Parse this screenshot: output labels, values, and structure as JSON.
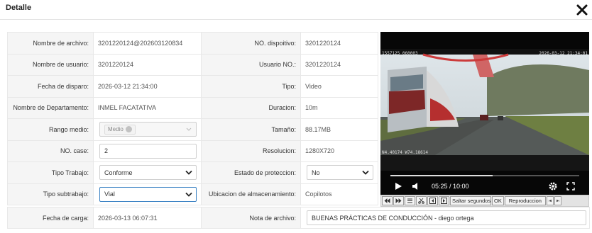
{
  "dialog": {
    "title": "Detalle",
    "close_icon": "close-icon"
  },
  "fields": {
    "nombre_archivo": {
      "label": "Nombre de archivo:",
      "value": "3201220124@202603120834"
    },
    "nombre_usuario": {
      "label": "Nombre de usuario:",
      "value": "3201220124"
    },
    "fecha_disparo": {
      "label": "Fecha de disparo:",
      "value": "2026-03-12 21:34:00"
    },
    "departamento": {
      "label": "Nombre de Departamento:",
      "value": "INMEL FACATATIVA"
    },
    "rango_medio": {
      "label": "Rango medio:",
      "tag": "Medio"
    },
    "no_case": {
      "label": "NO. case:",
      "value": "2"
    },
    "tipo_trabajo": {
      "label": "Tipo Trabajo:",
      "value": "Conforme"
    },
    "tipo_subtrabajo": {
      "label": "Tipo subtrabajo:",
      "value": "Vial"
    },
    "fecha_carga": {
      "label": "Fecha de carga:",
      "value": "2026-03-13 06:07:31"
    },
    "no_dispositivo": {
      "label": "NO. dispoitivo:",
      "value": "3201220124"
    },
    "usuario_no": {
      "label": "Usuario NO.:",
      "value": "3201220124"
    },
    "tipo": {
      "label": "Tipo:",
      "value": "Video"
    },
    "duracion": {
      "label": "Duracion:",
      "value": "10m"
    },
    "tamano": {
      "label": "Tamaño:",
      "value": "88.17MB"
    },
    "resolucion": {
      "label": "Resolucion:",
      "value": "1280X720"
    },
    "estado_proteccion": {
      "label": "Estado de proteccion:",
      "value": "No"
    },
    "ubicacion": {
      "label": "Ubicacion de almacenamiento:",
      "value": "Copilotos"
    },
    "nota": {
      "label": "Nota de archivo:",
      "value": "BUENAS PRÁCTICAS DE CONDUCCIÓN - diego ortega"
    }
  },
  "video": {
    "overlay_left": "1557125 060003",
    "overlay_right": "2026-03-12 21:34:01",
    "overlay_bottom": "N4.40174 W74.18614",
    "time": "05:25 / 10:00",
    "progress": 0.54,
    "icons": [
      "play-icon",
      "volume-icon",
      "gear-icon",
      "fullscreen-icon"
    ]
  },
  "controls": {
    "buttons": [
      {
        "name": "rewind-button",
        "icon": "rewind-icon"
      },
      {
        "name": "fast-forward-button",
        "icon": "fast-forward-icon"
      },
      {
        "name": "list-button",
        "icon": "list-icon"
      },
      {
        "name": "cut-button",
        "icon": "scissors-icon"
      },
      {
        "name": "frame-back-button",
        "icon": "frame-back-icon"
      },
      {
        "name": "frame-forward-button",
        "icon": "frame-forward-icon"
      }
    ],
    "skip_label": "Saltar segundos",
    "ok_label": "OK",
    "playback_label": "Reproduccion",
    "end_buttons": [
      "skip-start-icon",
      "skip-end-icon"
    ]
  }
}
